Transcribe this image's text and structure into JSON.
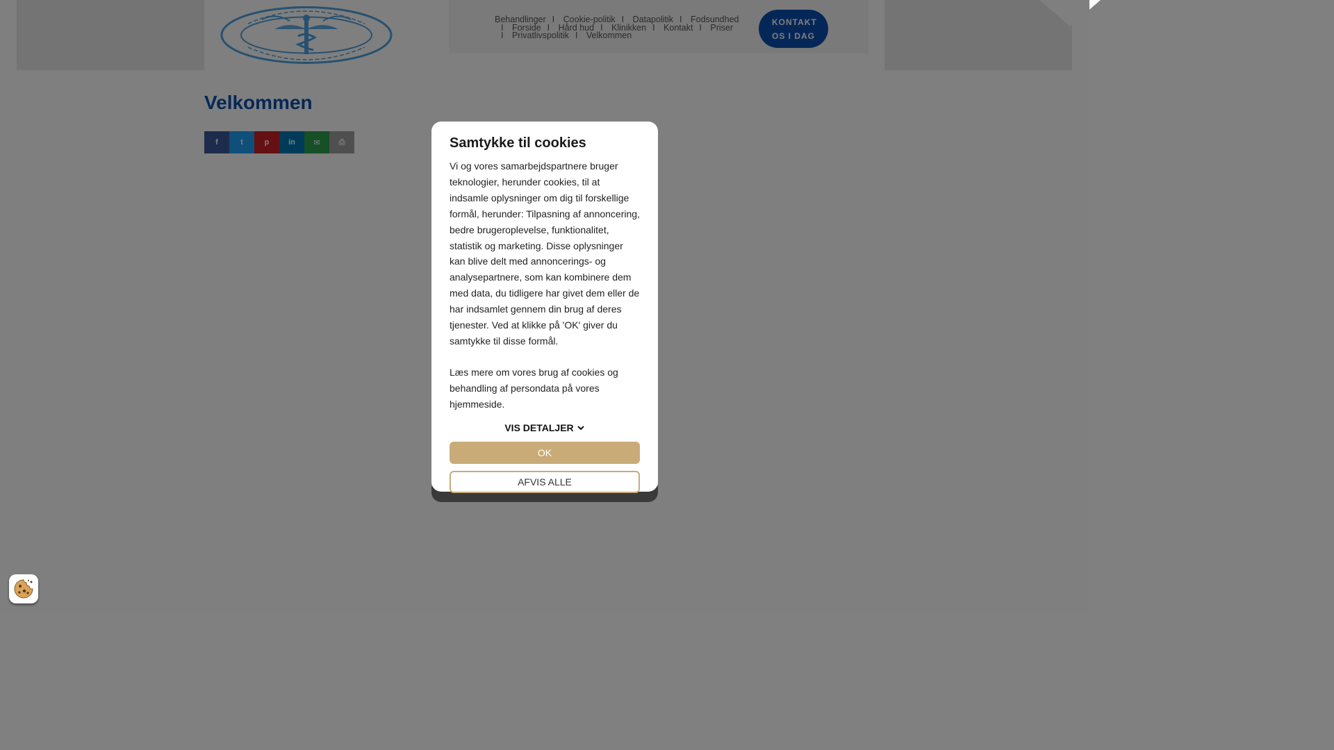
{
  "header": {
    "logo_alt": "Statsautoriseret fodterapeut",
    "nav": [
      "Behandlinger",
      "Cookie-politik",
      "Datapolitik",
      "Fodsundhed",
      "Forside",
      "Hård hud",
      "Klinikken",
      "Kontakt",
      "Priser",
      "Privatlivspolitik",
      "Velkommen"
    ],
    "cta_line1": "KONTAKT",
    "cta_line2": "OS I DAG"
  },
  "main": {
    "title": "Velkommen",
    "share": [
      {
        "name": "facebook",
        "glyph": "f",
        "color": "#3b5998"
      },
      {
        "name": "twitter",
        "glyph": "t",
        "color": "#1da1f2"
      },
      {
        "name": "pinterest",
        "glyph": "p",
        "color": "#cb2027"
      },
      {
        "name": "linkedin",
        "glyph": "in",
        "color": "#0077b5"
      },
      {
        "name": "email",
        "glyph": "✉",
        "color": "#2e9e4f"
      },
      {
        "name": "print",
        "glyph": "⎙",
        "color": "#9e9e9e"
      }
    ]
  },
  "cookie": {
    "title": "Samtykke til cookies",
    "body": "Vi og vores samarbejdspartnere bruger teknologier, herunder cookies, til at indsamle oplysninger om dig til forskellige formål, herunder: Tilpasning af annoncering, bedre brugeroplevelse, funktionalitet, statistik og marketing. Disse oplysninger kan blive delt med annoncerings- og analysepartnere, som kan kombinere dem med data, du tidligere har givet dem eller de har indsamlet gennem din brug af deres tjenester. Ved at klikke på 'OK' giver du samtykke til disse formål.",
    "body2": "Læs mere om vores brug af cookies og behandling af persondata på vores hjemmeside.",
    "details_label": "VIS DETALJER",
    "ok_label": "OK",
    "reject_label": "AFVIS ALLE"
  },
  "colors": {
    "brand_blue": "#0a4eb0",
    "accent_gold": "#c9ab78"
  }
}
